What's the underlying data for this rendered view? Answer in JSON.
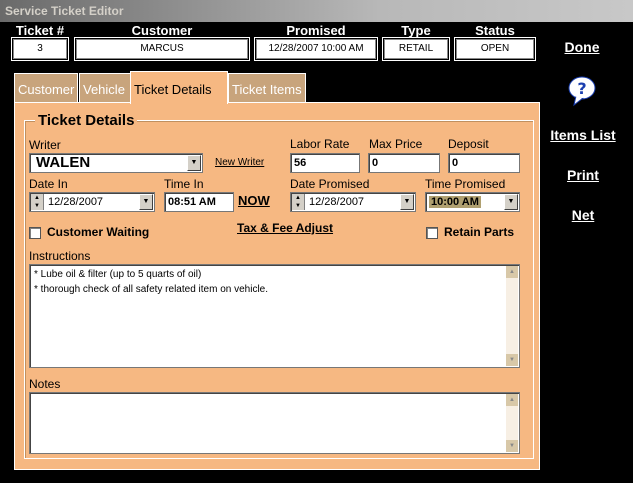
{
  "window": {
    "title": "Service Ticket Editor"
  },
  "header": {
    "ticket_label": "Ticket #",
    "ticket_value": "3",
    "customer_label": "Customer",
    "customer_value": "MARCUS",
    "promised_label": "Promised",
    "promised_value": "12/28/2007 10:00 AM",
    "type_label": "Type",
    "type_value": "RETAIL",
    "status_label": "Status",
    "status_value": "OPEN"
  },
  "side_links": {
    "done": "Done",
    "items_list": "Items List",
    "print": "Print",
    "net": "Net"
  },
  "tabs": [
    {
      "label": "Customer"
    },
    {
      "label": "Vehicle"
    },
    {
      "label": "Ticket Details"
    },
    {
      "label": "Ticket Items"
    }
  ],
  "details": {
    "group_title": "Ticket Details",
    "writer_label": "Writer",
    "writer_value": "WALEN",
    "new_writer": "New Writer",
    "labor_rate_label": "Labor Rate",
    "labor_rate_value": "56",
    "max_price_label": "Max Price",
    "max_price_value": "0",
    "deposit_label": "Deposit",
    "deposit_value": "0",
    "date_in_label": "Date In",
    "date_in_value": "12/28/2007",
    "time_in_label": "Time In",
    "time_in_value": "08:51 AM",
    "now": "NOW",
    "date_promised_label": "Date Promised",
    "date_promised_value": "12/28/2007",
    "time_promised_label": "Time Promised",
    "time_promised_value": "10:00 AM",
    "customer_waiting_label": "Customer Waiting",
    "tax_fee_adjust": "Tax & Fee Adjust",
    "retain_parts_label": "Retain Parts",
    "instructions_label": "Instructions",
    "instructions_lines": [
      "* Lube oil & filter (up to 5 quarts of oil)",
      "* thorough check of all safety related item on vehicle."
    ],
    "notes_label": "Notes"
  },
  "colors": {
    "panel": "#f6b882",
    "tab_inactive": "#c8a47c",
    "background": "#000000"
  }
}
